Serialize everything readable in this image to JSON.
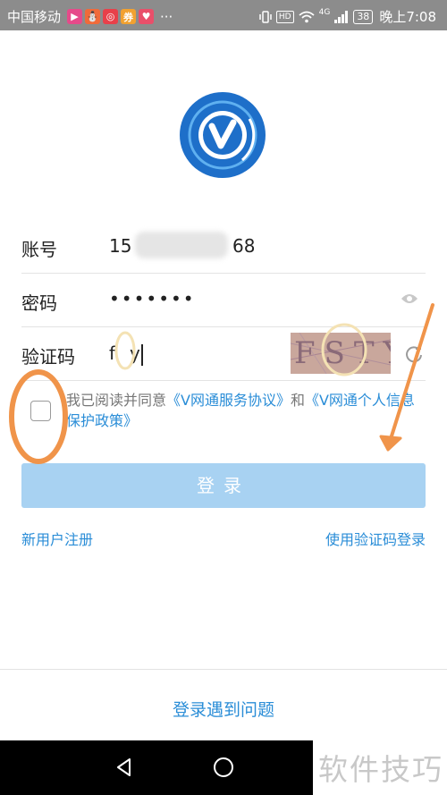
{
  "status_bar": {
    "carrier": "中国移动",
    "app_icons": [
      {
        "name": "video-app-icon",
        "glyph": "▶",
        "color": "#e64a8a"
      },
      {
        "name": "game-app-icon",
        "glyph": "⛄",
        "color": "#f06a3a"
      },
      {
        "name": "music-app-icon",
        "glyph": "◎",
        "color": "#e8404a"
      },
      {
        "name": "shop-app-icon",
        "glyph": "券",
        "color": "#f2a130"
      },
      {
        "name": "health-app-icon",
        "glyph": "♥",
        "color": "#e94f6a"
      }
    ],
    "overflow": "···",
    "hd": "HD",
    "network": "4G",
    "battery": "38",
    "time": "晚上7:08"
  },
  "form": {
    "account": {
      "label": "账号",
      "value_start": "15",
      "value_end": "68"
    },
    "password": {
      "label": "密码",
      "value": "•••••••"
    },
    "captcha": {
      "label": "验证码",
      "value_start": "f",
      "value_end": "y",
      "image_text": "FSTY"
    }
  },
  "agreement": {
    "prefix": "我已阅读并同意",
    "service_link": "《V网通服务协议》",
    "and": "和",
    "privacy_link": "《V网通个人信息保护政策》"
  },
  "login_button": "登录",
  "register_link": "新用户注册",
  "code_login_link": "使用验证码登录",
  "problem_link": "登录遇到问题",
  "watermark": "软件技巧",
  "colors": {
    "accent": "#2a8dd7",
    "button": "#a8d2f2",
    "logo": "#1e6fc9",
    "annotation_orange": "#f0944a",
    "annotation_yellow": "#f4e2b4"
  }
}
